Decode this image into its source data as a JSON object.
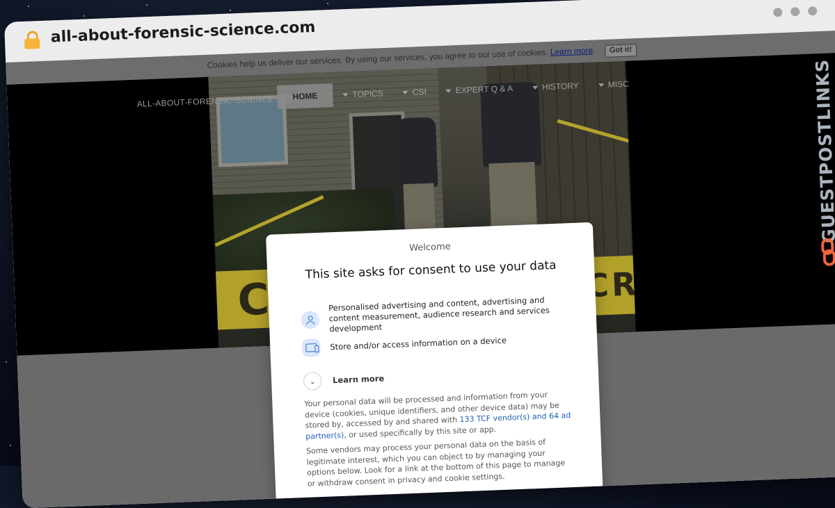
{
  "browser": {
    "url": "all-about-forensic-science.com"
  },
  "cookie_bar": {
    "message": "Cookies help us deliver our services. By using our services, you agree to our use of cookies.",
    "learn_more": "Learn more",
    "after_link": ".",
    "button": "Got it!"
  },
  "site": {
    "logo": "ALL-ABOUT-FORENSIC-SCIENCE.COM",
    "nav": {
      "home": "HOME",
      "topics": "TOPICS",
      "csi": "CSI",
      "expert": "EXPERT Q & A",
      "history": "HISTORY",
      "misc": "MISC"
    },
    "hero_tape_text_left": "C",
    "hero_tape_text_right": "CROS"
  },
  "consent": {
    "welcome": "Welcome",
    "heading": "This site asks for consent to use your data",
    "purposes": [
      {
        "icon": "person-icon",
        "label": "Personalised advertising and content, advertising and content measurement, audience research and services development"
      },
      {
        "icon": "device-icon",
        "label": "Store and/or access information on a device"
      }
    ],
    "learn_more": "Learn more",
    "paragraph1_before": "Your personal data will be processed and information from your device (cookies, unique identifiers, and other device data) may be stored by, accessed by and shared with ",
    "paragraph1_link": "133 TCF vendor(s) and 64 ad partner(s)",
    "paragraph1_after": ", or used specifically by this site or app.",
    "paragraph2": "Some vendors may process your personal data on the basis of legitimate interest, which you can object to by managing your options below. Look for a link at the bottom of this page to manage or withdraw consent in privacy and cookie settings."
  },
  "watermark": {
    "text": "GUESTPOSTLINKS"
  }
}
